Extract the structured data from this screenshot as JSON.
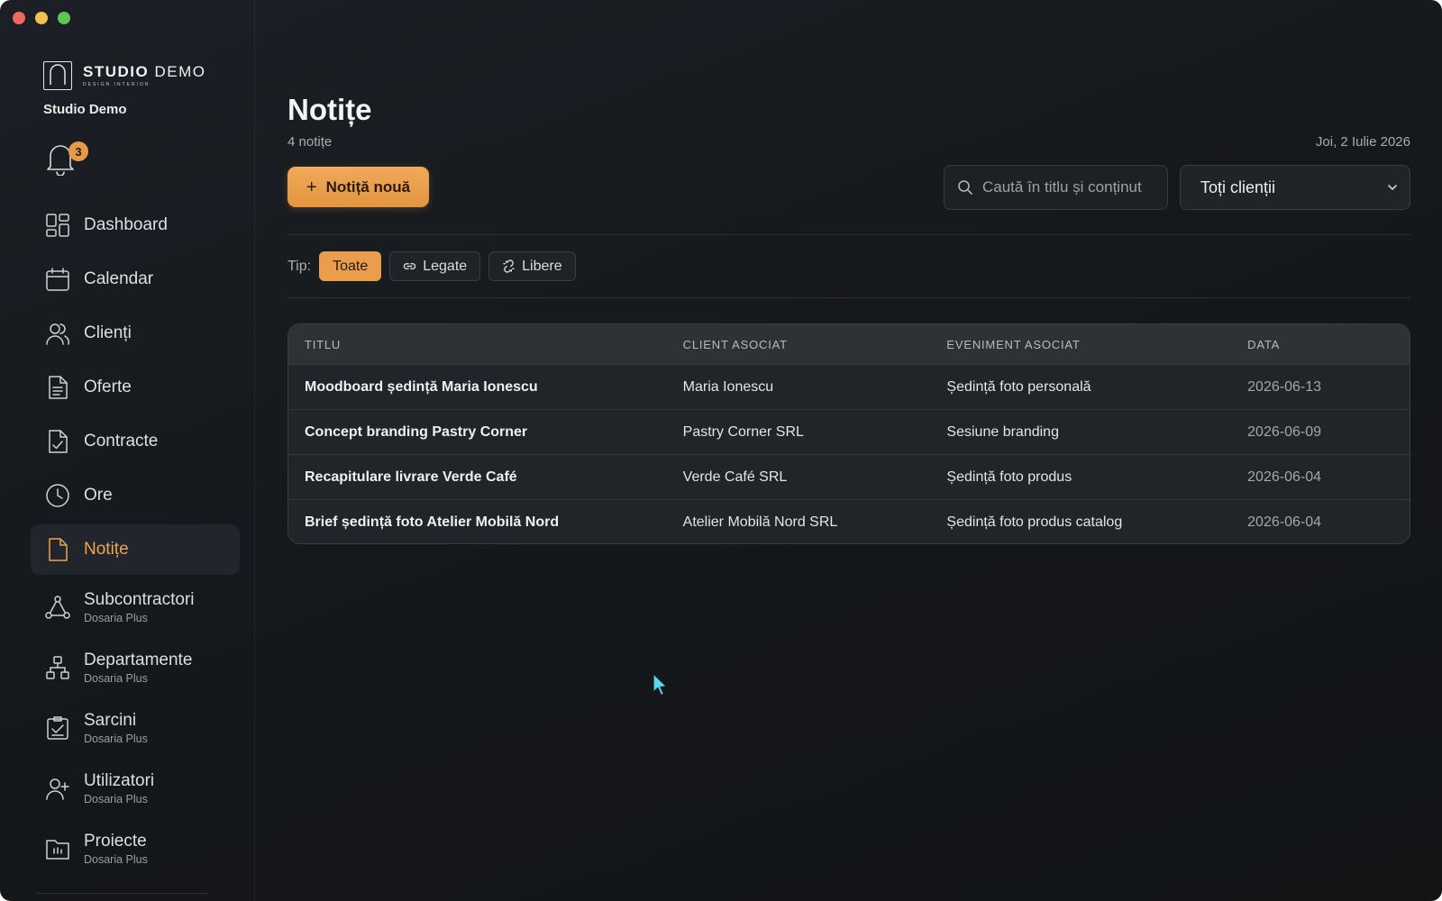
{
  "window": {
    "controls": [
      "close",
      "minimize",
      "maximize"
    ]
  },
  "brand": {
    "name_bold": "STUDIO",
    "name_light": " DEMO",
    "tagline": "DESIGN INTERIOR",
    "org": "Studio Demo"
  },
  "notifications": {
    "count": "3"
  },
  "sidebar": {
    "items": [
      {
        "label": "Dashboard",
        "icon": "dashboard-icon"
      },
      {
        "label": "Calendar",
        "icon": "calendar-icon"
      },
      {
        "label": "Clienți",
        "icon": "users-icon"
      },
      {
        "label": "Oferte",
        "icon": "document-icon"
      },
      {
        "label": "Contracte",
        "icon": "contract-icon"
      },
      {
        "label": "Ore",
        "icon": "clock-icon"
      },
      {
        "label": "Notițe",
        "icon": "note-icon",
        "active": true
      },
      {
        "label": "Subcontractori",
        "sub": "Dosaria Plus",
        "icon": "network-icon"
      },
      {
        "label": "Departamente",
        "sub": "Dosaria Plus",
        "icon": "org-chart-icon"
      },
      {
        "label": "Sarcini",
        "sub": "Dosaria Plus",
        "icon": "clipboard-check-icon"
      },
      {
        "label": "Utilizatori",
        "sub": "Dosaria Plus",
        "icon": "user-plus-icon"
      },
      {
        "label": "Proiecte",
        "sub": "Dosaria Plus",
        "icon": "folder-icon"
      }
    ]
  },
  "header": {
    "title": "Notițe",
    "count": "4 notițe",
    "date": "Joi, 2 Iulie 2026"
  },
  "toolbar": {
    "new_plus": "+",
    "new_label": "Notiță nouă",
    "search_placeholder": "Caută în titlu și conținut",
    "client_select": "Toți clienții"
  },
  "filters": {
    "label": "Tip:",
    "options": [
      {
        "label": "Toate",
        "active": true
      },
      {
        "label": "Legate",
        "icon": "link-icon"
      },
      {
        "label": "Libere",
        "icon": "unlink-icon"
      }
    ]
  },
  "table": {
    "headers": [
      "TITLU",
      "CLIENT ASOCIAT",
      "EVENIMENT ASOCIAT",
      "DATA"
    ],
    "rows": [
      [
        "Moodboard ședință Maria Ionescu",
        "Maria Ionescu",
        "Ședință foto personală",
        "2026-06-13"
      ],
      [
        "Concept branding Pastry Corner",
        "Pastry Corner SRL",
        "Sesiune branding",
        "2026-06-09"
      ],
      [
        "Recapitulare livrare Verde Café",
        "Verde Café SRL",
        "Ședință foto produs",
        "2026-06-04"
      ],
      [
        "Brief ședință foto Atelier Mobilă Nord",
        "Atelier Mobilă Nord SRL",
        "Ședință foto produs catalog",
        "2026-06-04"
      ]
    ]
  },
  "colors": {
    "accent": "#e99e4d",
    "background": "#16191d",
    "text": "#e8e8ea"
  }
}
